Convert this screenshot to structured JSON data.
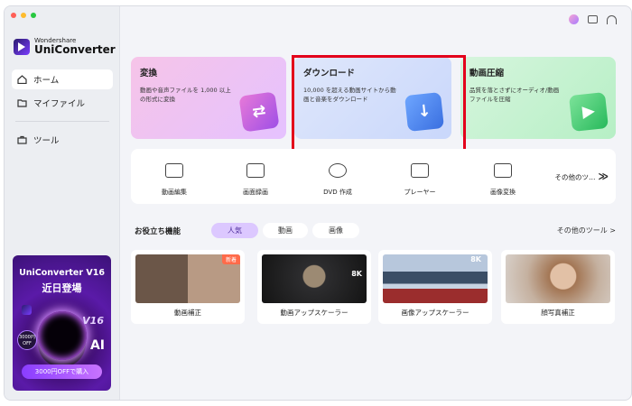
{
  "window": {
    "traffic_colors": [
      "#ff5f57",
      "#febc2e",
      "#28c840"
    ]
  },
  "sidebar": {
    "logo_small": "Wondershare",
    "logo_big": "UniConverter",
    "items": [
      {
        "label": "ホーム",
        "icon": "home-icon",
        "active": true
      },
      {
        "label": "マイファイル",
        "icon": "folder-icon",
        "active": false
      },
      {
        "label": "ツール",
        "icon": "toolbox-icon",
        "active": false
      }
    ],
    "promo": {
      "title": "UniConverter V16",
      "subtitle": "近日登場",
      "badge": "3000円 OFF",
      "v16": "V16",
      "ai": "AI",
      "button": "3000円OFFで購入"
    }
  },
  "topbar": {
    "icons": [
      "avatar",
      "chat-icon",
      "headset-icon"
    ]
  },
  "hero_cards": [
    {
      "title": "変換",
      "desc": "動画や音声ファイルを 1,000 以上の形式に変換",
      "glyph": "⇄"
    },
    {
      "title": "ダウンロード",
      "desc": "10,000 を超える動画サイトから動画と音楽をダウンロード",
      "glyph": "↓"
    },
    {
      "title": "動画圧縮",
      "desc": "品質を落とさずにオーディオ/動画ファイルを圧縮",
      "glyph": "▶"
    }
  ],
  "tools": {
    "items": [
      {
        "label": "動画編集",
        "icon": "video-edit-icon"
      },
      {
        "label": "画面録画",
        "icon": "screen-record-icon"
      },
      {
        "label": "DVD 作成",
        "icon": "dvd-icon"
      },
      {
        "label": "プレーヤー",
        "icon": "player-icon"
      },
      {
        "label": "画像変換",
        "icon": "image-convert-icon"
      }
    ],
    "more": "その他のツ…",
    "more_arrow": "≫"
  },
  "section": {
    "title": "お役立ち機能",
    "tabs": [
      "人気",
      "動画",
      "画像"
    ],
    "active_tab": "人気",
    "more": "その他のツール >"
  },
  "feature_cards": [
    {
      "label": "動画補正",
      "badge": "新着"
    },
    {
      "label": "動画アップスケーラー",
      "badge": "8K"
    },
    {
      "label": "画像アップスケーラー",
      "badge": "8K"
    },
    {
      "label": "顔写真補正",
      "badge": ""
    }
  ]
}
